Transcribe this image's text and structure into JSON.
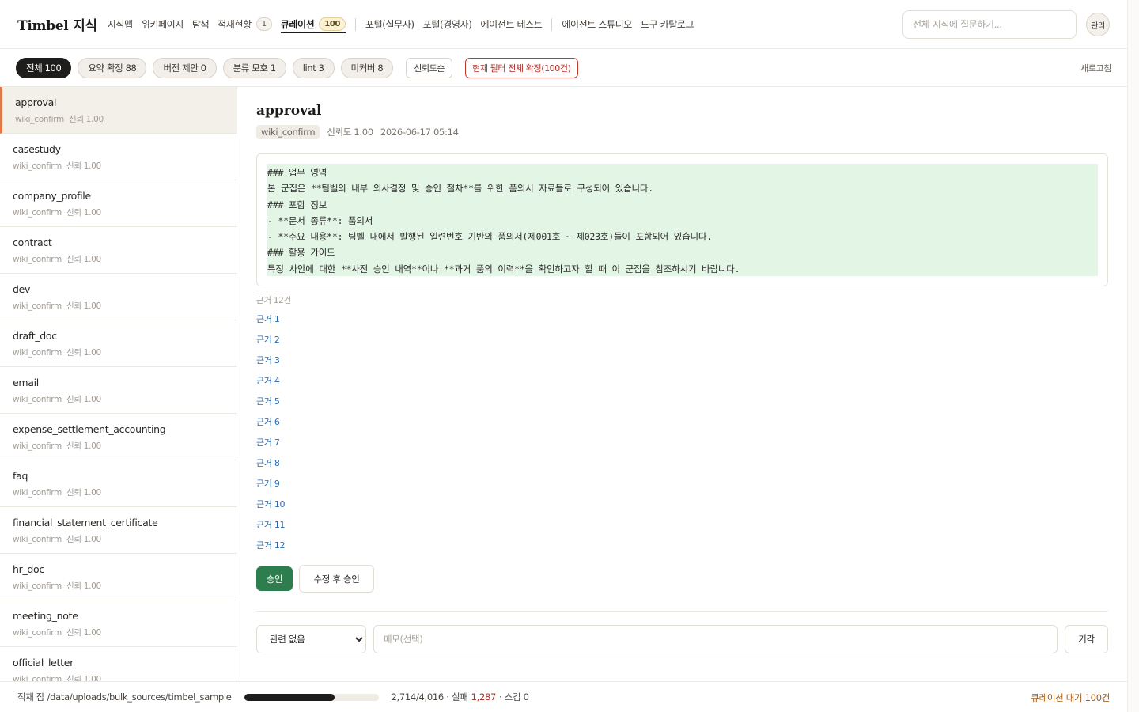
{
  "brand": "Timbel 지식",
  "nav": {
    "items": [
      {
        "label": "지식맵"
      },
      {
        "label": "위키페이지"
      },
      {
        "label": "탐색"
      },
      {
        "label": "적재현황",
        "badge": "1"
      },
      {
        "label": "큐레이션",
        "badge": "100",
        "active": true
      },
      {
        "label": "포털(실무자)"
      },
      {
        "label": "포털(경영자)"
      },
      {
        "label": "에이전트 테스트"
      },
      {
        "label": "에이전트 스튜디오"
      },
      {
        "label": "도구 카탈로그"
      }
    ],
    "ask_placeholder": "전체 지식에 질문하기...",
    "admin_label": "관리"
  },
  "filters": {
    "chips": [
      "전체 100",
      "요약 확정 88",
      "버전 제안 0",
      "분류 모호 1",
      "lint 3",
      "미커버 8"
    ],
    "sort_label": "신뢰도순",
    "confirm_all_label": "현재 필터 전체 확정(100건)",
    "refresh_label": "새로고침"
  },
  "list": [
    {
      "title": "approval",
      "source": "wiki_confirm",
      "trust": "신뢰 1.00"
    },
    {
      "title": "casestudy",
      "source": "wiki_confirm",
      "trust": "신뢰 1.00"
    },
    {
      "title": "company_profile",
      "source": "wiki_confirm",
      "trust": "신뢰 1.00"
    },
    {
      "title": "contract",
      "source": "wiki_confirm",
      "trust": "신뢰 1.00"
    },
    {
      "title": "dev",
      "source": "wiki_confirm",
      "trust": "신뢰 1.00"
    },
    {
      "title": "draft_doc",
      "source": "wiki_confirm",
      "trust": "신뢰 1.00"
    },
    {
      "title": "email",
      "source": "wiki_confirm",
      "trust": "신뢰 1.00"
    },
    {
      "title": "expense_settlement_accounting",
      "source": "wiki_confirm",
      "trust": "신뢰 1.00"
    },
    {
      "title": "faq",
      "source": "wiki_confirm",
      "trust": "신뢰 1.00"
    },
    {
      "title": "financial_statement_certificate",
      "source": "wiki_confirm",
      "trust": "신뢰 1.00"
    },
    {
      "title": "hr_doc",
      "source": "wiki_confirm",
      "trust": "신뢰 1.00"
    },
    {
      "title": "meeting_note",
      "source": "wiki_confirm",
      "trust": "신뢰 1.00"
    },
    {
      "title": "official_letter",
      "source": "wiki_confirm",
      "trust": "신뢰 1.00"
    }
  ],
  "detail": {
    "title": "approval",
    "tag": "wiki_confirm",
    "trust": "신뢰도 1.00",
    "timestamp": "2026-06-17 05:14",
    "summary_lines": [
      "### 업무 영역",
      "본 군집은 **팀벨의 내부 의사결정 및 승인 절차**를 위한 품의서 자료들로 구성되어 있습니다.",
      "### 포함 정보",
      "- **문서 종류**: 품의서",
      "- **주요 내용**: 팀벨 내에서 발행된 일련번호 기반의 품의서(제001호 ~ 제023호)들이 포함되어 있습니다.",
      "### 활용 가이드",
      "특정 사안에 대한 **사전 승인 내역**이나 **과거 품의 이력**을 확인하고자 할 때 이 군집을 참조하시기 바랍니다."
    ],
    "evidence_count": "근거 12건",
    "evidence": [
      "근거 1",
      "근거 2",
      "근거 3",
      "근거 4",
      "근거 5",
      "근거 6",
      "근거 7",
      "근거 8",
      "근거 9",
      "근거 10",
      "근거 11",
      "근거 12"
    ],
    "approve_label": "승인",
    "edit_approve_label": "수정 후 승인",
    "relation_options": [
      "관련 없음"
    ],
    "memo_placeholder": "메모(선택)",
    "reject_label": "기각"
  },
  "status": {
    "path": "적재 잡 /data/uploads/bulk_sources/timbel_sample",
    "progress_fraction": 0.676,
    "progress_text": "2,714/4,016 · 실패",
    "fail_count": "1,287",
    "skip_text": "· 스킵 0",
    "queue_text": "큐레이션 대기 100건"
  },
  "colors": {
    "accent": "#e0794a",
    "approve": "#2e7d4f",
    "danger": "#b0302a",
    "summary_bg": "#e3f5e4",
    "link": "#2a6aad"
  }
}
